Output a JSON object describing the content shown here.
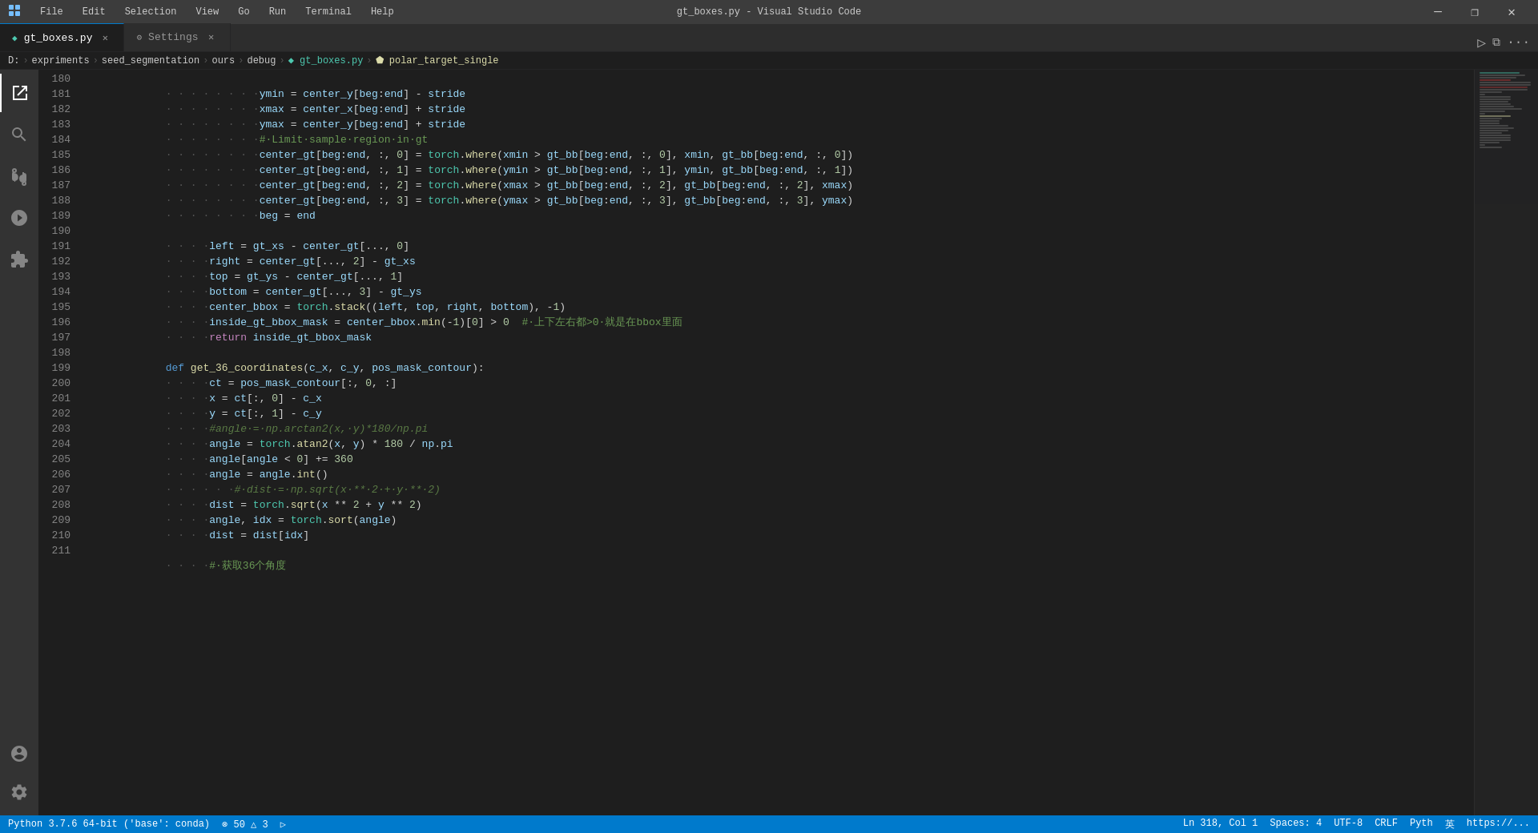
{
  "titleBar": {
    "title": "gt_boxes.py - Visual Studio Code",
    "menus": [
      "File",
      "Edit",
      "Selection",
      "View",
      "Go",
      "Run",
      "Terminal",
      "Help"
    ],
    "winMin": "—",
    "winMax": "❐",
    "winClose": "✕"
  },
  "tabs": [
    {
      "id": "gt_boxes",
      "label": "gt_boxes.py",
      "active": true,
      "icon": "py"
    },
    {
      "id": "settings",
      "label": "Settings",
      "active": false,
      "icon": "settings"
    }
  ],
  "breadcrumb": [
    "D:",
    "expriments",
    "seed_segmentation",
    "ours",
    "debug",
    "gt_boxes.py",
    "polar_target_single"
  ],
  "lines": [
    {
      "num": 180,
      "code": "        ymin = center_y[beg:end] - stride"
    },
    {
      "num": 181,
      "code": "        xmax = center_x[beg:end] + stride"
    },
    {
      "num": 182,
      "code": "        ymax = center_y[beg:end] + stride"
    },
    {
      "num": 183,
      "code": "        #·Limit·sample·region·in·gt"
    },
    {
      "num": 184,
      "code": "        center_gt[beg:end, :, 0] = torch.where(xmin > gt_bb[beg:end, :, 0], xmin, gt_bb[beg:end, :, 0])"
    },
    {
      "num": 185,
      "code": "        center_gt[beg:end, :, 1] = torch.where(ymin > gt_bb[beg:end, :, 1], ymin, gt_bb[beg:end, :, 1])"
    },
    {
      "num": 186,
      "code": "        center_gt[beg:end, :, 2] = torch.where(xmax > gt_bb[beg:end, :, 2], gt_bb[beg:end, :, 2], xmax)"
    },
    {
      "num": 187,
      "code": "        center_gt[beg:end, :, 3] = torch.where(ymax > gt_bb[beg:end, :, 3], gt_bb[beg:end, :, 3], ymax)"
    },
    {
      "num": 188,
      "code": "        beg = end"
    },
    {
      "num": 189,
      "code": ""
    },
    {
      "num": 190,
      "code": "    left = gt_xs - center_gt[..., 0]"
    },
    {
      "num": 191,
      "code": "    right = center_gt[..., 2] - gt_xs"
    },
    {
      "num": 192,
      "code": "    top = gt_ys - center_gt[..., 1]"
    },
    {
      "num": 193,
      "code": "    bottom = center_gt[..., 3] - gt_ys"
    },
    {
      "num": 194,
      "code": "    center_bbox = torch.stack((left, top, right, bottom), -1)"
    },
    {
      "num": 195,
      "code": "    inside_gt_bbox_mask = center_bbox.min(-1)[0] > 0  #·上下左右都>0·就是在bbox里面"
    },
    {
      "num": 196,
      "code": "    return inside_gt_bbox_mask"
    },
    {
      "num": 197,
      "code": ""
    },
    {
      "num": 198,
      "code": "def get_36_coordinates(c_x, c_y, pos_mask_contour):"
    },
    {
      "num": 199,
      "code": "    ct = pos_mask_contour[:, 0, :]"
    },
    {
      "num": 200,
      "code": "    x = ct[:, 0] - c_x"
    },
    {
      "num": 201,
      "code": "    y = ct[:, 1] - c_y"
    },
    {
      "num": 202,
      "code": "    #angle·=·np.arctan2(x,·y)*180/np.pi"
    },
    {
      "num": 203,
      "code": "    angle = torch.atan2(x, y) * 180 / np.pi"
    },
    {
      "num": 204,
      "code": "    angle[angle < 0] += 360"
    },
    {
      "num": 205,
      "code": "    angle = angle.int()"
    },
    {
      "num": 206,
      "code": "    #·dist·=·np.sqrt(x·**·2·+·y·**·2)"
    },
    {
      "num": 207,
      "code": "    dist = torch.sqrt(x ** 2 + y ** 2)"
    },
    {
      "num": 208,
      "code": "    angle, idx = torch.sort(angle)"
    },
    {
      "num": 209,
      "code": "    dist = dist[idx]"
    },
    {
      "num": 210,
      "code": ""
    },
    {
      "num": 211,
      "code": "    #·获取36个角度"
    }
  ],
  "statusBar": {
    "python": "Python 3.7.6 64-bit ('base': conda)",
    "errors": "⊗ 50  △ 3",
    "run": "▷",
    "position": "Ln 318, Col 1",
    "spaces": "Spaces: 4",
    "encoding": "UTF-8",
    "eol": "CRLF",
    "language": "Pyth",
    "rightInfo": "英",
    "url": "https://..."
  }
}
